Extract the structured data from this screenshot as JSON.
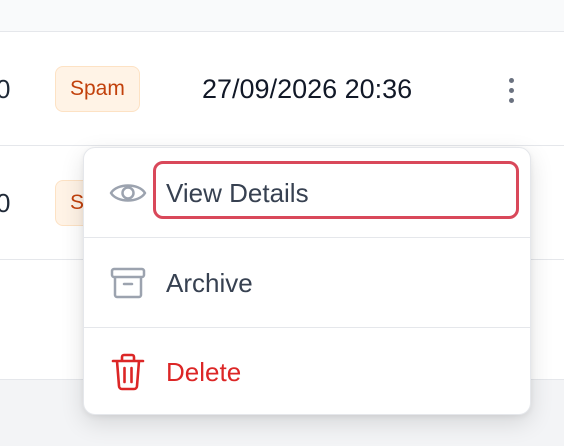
{
  "rows": [
    {
      "count": "0",
      "badge": "Spam",
      "timestamp": "27/09/2026 20:36"
    },
    {
      "count": "0",
      "badge": "S"
    }
  ],
  "menu": {
    "items": [
      {
        "label": "View Details",
        "icon": "eye-icon"
      },
      {
        "label": "Archive",
        "icon": "archive-box-icon"
      },
      {
        "label": "Delete",
        "icon": "trash-icon"
      }
    ]
  },
  "colors": {
    "badge_text": "#c2410c",
    "badge_bg": "#fff3e6",
    "delete": "#dc2626",
    "focus_ring": "#d9485a"
  }
}
